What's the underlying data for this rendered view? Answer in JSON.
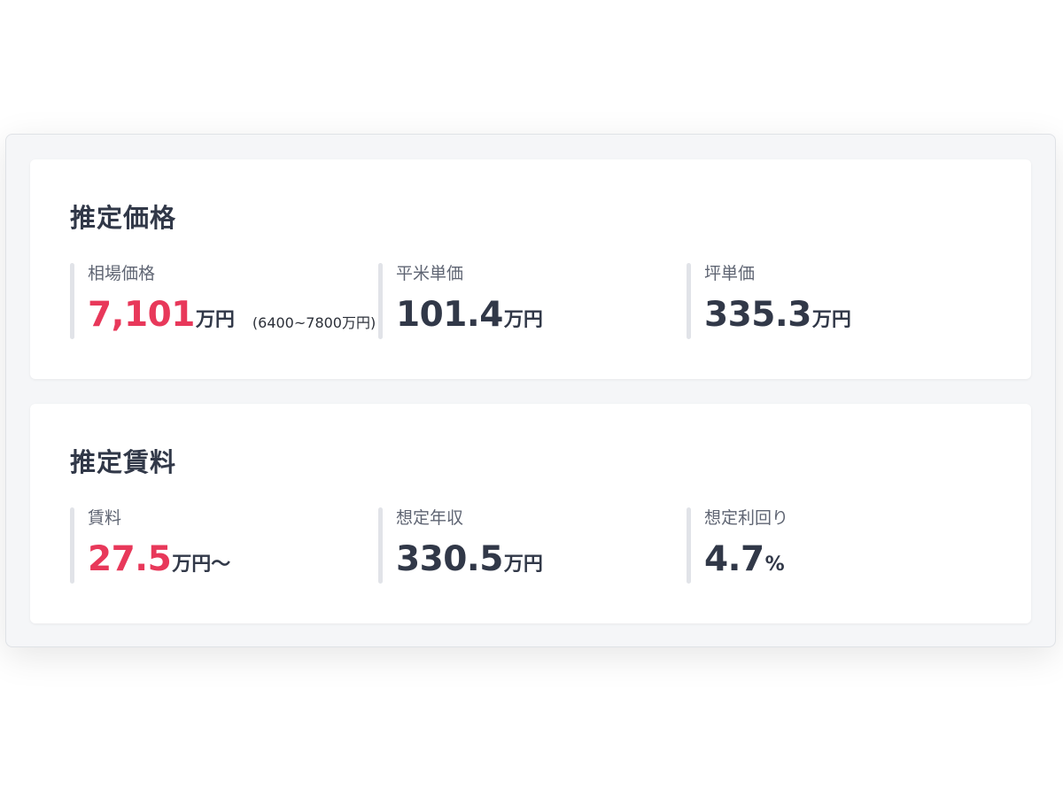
{
  "price_card": {
    "title": "推定価格",
    "metrics": [
      {
        "label": "相場価格",
        "value": "7,101",
        "unit": "万円",
        "range": "(6400~7800万円)"
      },
      {
        "label": "平米単価",
        "value": "101.4",
        "unit": "万円"
      },
      {
        "label": "坪単価",
        "value": "335.3",
        "unit": "万円"
      }
    ]
  },
  "rent_card": {
    "title": "推定賃料",
    "metrics": [
      {
        "label": "賃料",
        "value": "27.5",
        "unit": "万円〜"
      },
      {
        "label": "想定年収",
        "value": "330.5",
        "unit": "万円"
      },
      {
        "label": "想定利回り",
        "value": "4.7",
        "unit": "%"
      }
    ]
  },
  "colors": {
    "accent": "#e8385a",
    "text_dark": "#313848",
    "label_gray": "#5f6573",
    "divider": "#e1e3e8",
    "panel_bg": "#f5f6f8"
  }
}
